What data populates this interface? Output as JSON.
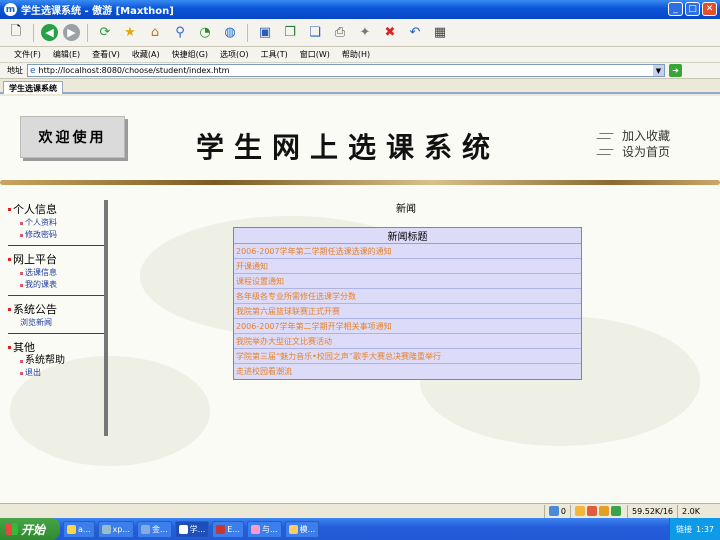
{
  "window": {
    "title": "学生选课系统 - 傲游 [Maxthon]"
  },
  "menu": [
    "文件(F)",
    "编辑(E)",
    "查看(V)",
    "收藏(A)",
    "快捷组(G)",
    "选项(O)",
    "工具(T)",
    "窗口(W)",
    "帮助(H)"
  ],
  "address": {
    "label": "地址",
    "url": "http://localhost:8080/choose/student/index.htm"
  },
  "tab": {
    "label": "学生选课系统"
  },
  "header": {
    "welcome": "欢迎使用",
    "site_title": "学生网上选课系统",
    "add_favorite": "加入收藏",
    "set_home": "设为首页"
  },
  "nav": [
    {
      "title": "个人信息",
      "items": [
        "个人资料",
        "修改密码"
      ]
    },
    {
      "title": "网上平台",
      "items": [
        "选课信息",
        "我的课表"
      ]
    },
    {
      "title": "系统公告",
      "items": [
        "浏览新闻"
      ]
    },
    {
      "title": "其他",
      "items": [
        "系统帮助",
        "退出"
      ]
    }
  ],
  "news": {
    "heading": "新闻",
    "column": "新闻标题",
    "rows": [
      "2006-2007学年第二学期任选课选课的通知",
      "开课通知",
      "课程设置通知",
      "各年级各专业所需修任选课学分数",
      "我院第六届篮球联赛正式开赛",
      "2006-2007学年第二学期开学相关事项通知",
      "我院举办大型征文比赛活动",
      "学院第三届“魅力音乐•校园之声”歌手大赛总决赛隆重举行",
      "走进校园看潮流"
    ]
  },
  "status": {
    "count": "0",
    "speed": "59.52K/16",
    "percent": "2.0K"
  },
  "taskbar": {
    "start": "开始",
    "tasks": [
      "a...",
      "xp...",
      "金...",
      "学...",
      "E...",
      "与...",
      "模..."
    ],
    "tray_label": "链接",
    "clock": "1:37"
  }
}
